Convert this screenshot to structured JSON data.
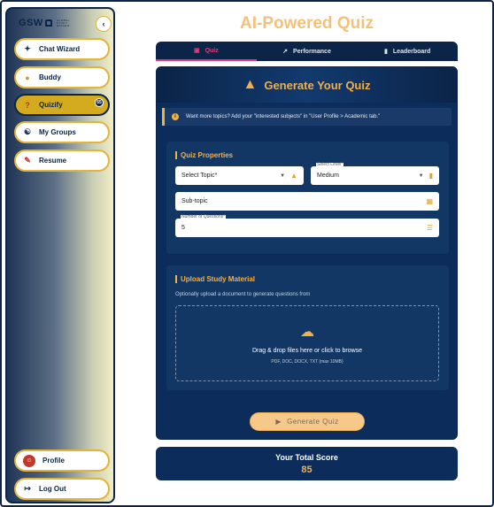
{
  "sidebar": {
    "logo_text": "GSW",
    "logo_subtext": "GLOBAL STUDY WIZARD",
    "collapse_icon": "chevron-left",
    "items": [
      {
        "label": "Chat Wizard",
        "icon": "wand-icon"
      },
      {
        "label": "Buddy",
        "icon": "buddy-icon"
      },
      {
        "label": "Quizify",
        "icon": "question-icon",
        "active": true,
        "badge": "65"
      },
      {
        "label": "My Groups",
        "icon": "groups-icon"
      },
      {
        "label": "Resume",
        "icon": "resume-icon"
      }
    ],
    "bottom_items": [
      {
        "label": "Profile",
        "icon": "avatar-icon"
      },
      {
        "label": "Log Out",
        "icon": "logout-icon"
      }
    ]
  },
  "page": {
    "title": "AI-Powered Quiz"
  },
  "tabs": [
    {
      "label": "Quiz",
      "active": true
    },
    {
      "label": "Performance"
    },
    {
      "label": "Leaderboard"
    }
  ],
  "card": {
    "heading": "Generate Your Quiz",
    "info_text": "Want more topics? Add your \"interested subjects\" in \"User Profile > Academic tab.\"",
    "properties": {
      "title": "Quiz Properties",
      "topic_placeholder": "Select Topic*",
      "level_label": "Select Level*",
      "level_value": "Medium",
      "subtopic_placeholder": "Sub-topic",
      "num_questions_label": "Number of Questions*",
      "num_questions_value": "5"
    },
    "upload": {
      "title": "Upload Study Material",
      "description": "Optionally upload a document to generate questions from",
      "drop_main": "Drag & drop files here or click to browse",
      "drop_sub": "PDF, DOC, DOCX, TXT (max 10MB)"
    },
    "generate_label": "Generate Quiz"
  },
  "score": {
    "label": "Your Total Score",
    "value": "85"
  },
  "colors": {
    "navy": "#0b2447",
    "card": "#0c2d5c",
    "accent": "#f2b04b",
    "title": "#f2c27a",
    "active_tab": "#e23b7a"
  }
}
